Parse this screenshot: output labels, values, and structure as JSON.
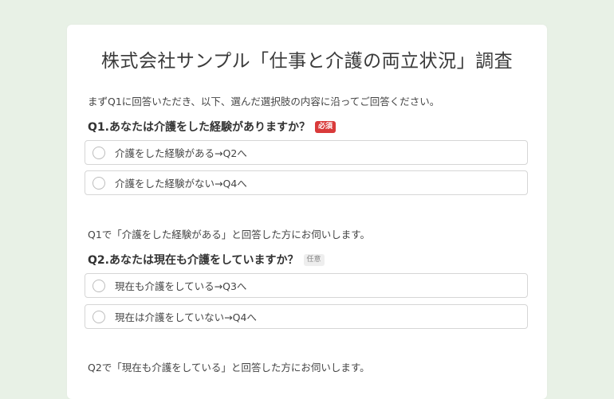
{
  "survey": {
    "title": "株式会社サンプル「仕事と介護の両立状況」調査",
    "intro": "まずQ1に回答いただき、以下、選んだ選択肢の内容に沿ってご回答ください。"
  },
  "q1": {
    "text": "Q1.あなたは介護をした経験がありますか？",
    "badge": "必須",
    "options": [
      {
        "label": "介護をした経験がある→Q2へ"
      },
      {
        "label": "介護をした経験がない→Q4へ"
      }
    ]
  },
  "q2": {
    "note": "Q1で「介護をした経験がある」と回答した方にお伺いします。",
    "text": "Q2.あなたは現在も介護をしていますか？",
    "badge": "任意",
    "options": [
      {
        "label": "現在も介護をしている→Q3へ"
      },
      {
        "label": "現在は介護をしていない→Q4へ"
      }
    ]
  },
  "q3": {
    "note": "Q2で「現在も介護をしている」と回答した方にお伺いします。"
  },
  "colors": {
    "background": "#e8f1e6",
    "required_badge": "#d93a3a",
    "optional_badge": "#eeeeee"
  }
}
